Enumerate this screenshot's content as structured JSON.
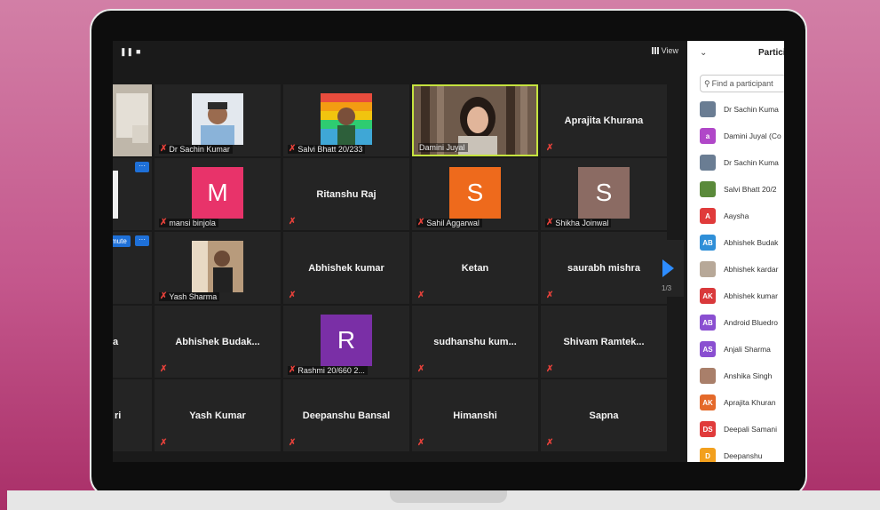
{
  "top_bar": {
    "view_label": "View"
  },
  "tiles": [
    {
      "name": "Dr Sachin Kumar",
      "kind": "photo"
    },
    {
      "name": "Salvi Bhatt 20/233",
      "kind": "photo"
    },
    {
      "name": "Damini Juyal",
      "kind": "photo",
      "active": true
    },
    {
      "name": "Aprajita Khurana",
      "kind": "name"
    },
    {
      "name": "mansi binjola",
      "kind": "letter",
      "letter": "M",
      "color": "#e8336a"
    },
    {
      "name": "Ritanshu Raj",
      "kind": "name"
    },
    {
      "name": "Sahil Aggarwal",
      "kind": "letter",
      "letter": "S",
      "color": "#ee6a1c"
    },
    {
      "name": "Shikha Joinwal",
      "kind": "letter",
      "letter": "S",
      "color": "#8b6b63"
    },
    {
      "name": "Yash Sharma",
      "kind": "photo"
    },
    {
      "name": "Abhishek kumar",
      "kind": "name"
    },
    {
      "name": "Ketan",
      "kind": "name"
    },
    {
      "name": "saurabh mishra",
      "kind": "name"
    },
    {
      "name": "Abhishek  Budak...",
      "kind": "name"
    },
    {
      "name": "Rashmi 20/660 2...",
      "kind": "letter",
      "letter": "R",
      "color": "#7a2fa6"
    },
    {
      "name": "sudhanshu  kum...",
      "kind": "name"
    },
    {
      "name": "Shivam  Ramtek...",
      "kind": "name"
    },
    {
      "name": "Yash Kumar",
      "kind": "name"
    },
    {
      "name": "Deepanshu Bansal",
      "kind": "name"
    },
    {
      "name": "Himanshi",
      "kind": "name"
    },
    {
      "name": "Sapna",
      "kind": "name"
    }
  ],
  "partial_tiles": {
    "row4_fragment": "a",
    "row5_fragment": "ri",
    "unmute_label": "mute",
    "more_label": "···"
  },
  "pagination": {
    "indicator": "1/3"
  },
  "participants_panel": {
    "title": "Partici",
    "search_placeholder": "Find a participant",
    "items": [
      {
        "name": "Dr Sachin Kuma",
        "avatar": "photo",
        "color": "#6a7d93"
      },
      {
        "name": "Damini Juyal (Co",
        "avatar": "a",
        "color": "#b047c8"
      },
      {
        "name": "Dr Sachin Kuma",
        "avatar": "photo",
        "color": "#6a7d93"
      },
      {
        "name": "Salvi Bhatt 20/2",
        "avatar": "photo",
        "color": "#5a8a3a"
      },
      {
        "name": "Aaysha",
        "avatar": "A",
        "color": "#e03b3b"
      },
      {
        "name": "Abhishek Budak",
        "avatar": "AB",
        "color": "#2f8fd8"
      },
      {
        "name": "Abhishek kardar",
        "avatar": "photo",
        "color": "#b7a898"
      },
      {
        "name": "Abhishek kumar",
        "avatar": "AK",
        "color": "#d9393b"
      },
      {
        "name": "Android Bluedro",
        "avatar": "AB",
        "color": "#8a4fd1"
      },
      {
        "name": "Anjali Sharma",
        "avatar": "AS",
        "color": "#8a4fd1"
      },
      {
        "name": "Anshika Singh",
        "avatar": "photo",
        "color": "#a97f6a"
      },
      {
        "name": "Aprajita Khuran",
        "avatar": "AK",
        "color": "#e4692a"
      },
      {
        "name": "Deepali Samani",
        "avatar": "DS",
        "color": "#e03b3b"
      },
      {
        "name": "Deepanshu",
        "avatar": "D",
        "color": "#f2a01e"
      }
    ]
  }
}
